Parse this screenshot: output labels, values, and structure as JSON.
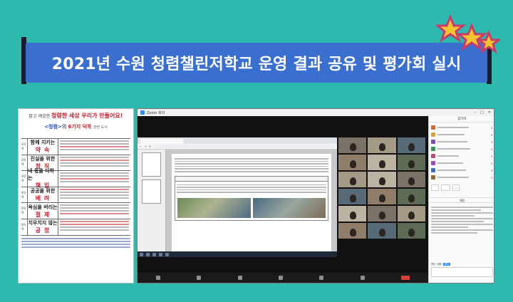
{
  "banner": {
    "title": "2021년 수원 청렴챌린저학교 운영 결과 공유 및 평가회 실시"
  },
  "poster": {
    "header_prefix": "밝고 깨끗한",
    "header_emph": "청렴한 세상 우리가 만들어요!",
    "subtitle_tag": "<청렴>",
    "subtitle_mid": "의",
    "subtitle_red": "6가지 덕목",
    "subtitle_end": "관련 도서",
    "rows": [
      {
        "num": "1덕목",
        "line1": "함께 지키는",
        "line2": "약 속"
      },
      {
        "num": "2덕목",
        "line1": "진실을 위한",
        "line2": "정 직"
      },
      {
        "num": "3덕목",
        "line1": "내 몫을 다하는",
        "line2": "책 임"
      },
      {
        "num": "4덕목",
        "line1": "공공을 위한",
        "line2": "배 려"
      },
      {
        "num": "5덕목",
        "line1": "욕심을 버리는",
        "line2": "절 제"
      },
      {
        "num": "6덕목",
        "line1": "치우치지 않는",
        "line2": "공 정"
      }
    ]
  },
  "zoom": {
    "window_title": "Zoom 회의",
    "panel_title": "참가자",
    "chat_title": "채팅",
    "chat_to_label": "받는 사람:",
    "chat_to_value": "모두",
    "colors": {
      "accent": "#2d8cff",
      "end": "#d9403a"
    }
  },
  "colors": {
    "background": "#2fb8ad",
    "banner": "#3a6fd0",
    "poster_red": "#c21d2b",
    "poster_blue": "#2a4bc9"
  }
}
